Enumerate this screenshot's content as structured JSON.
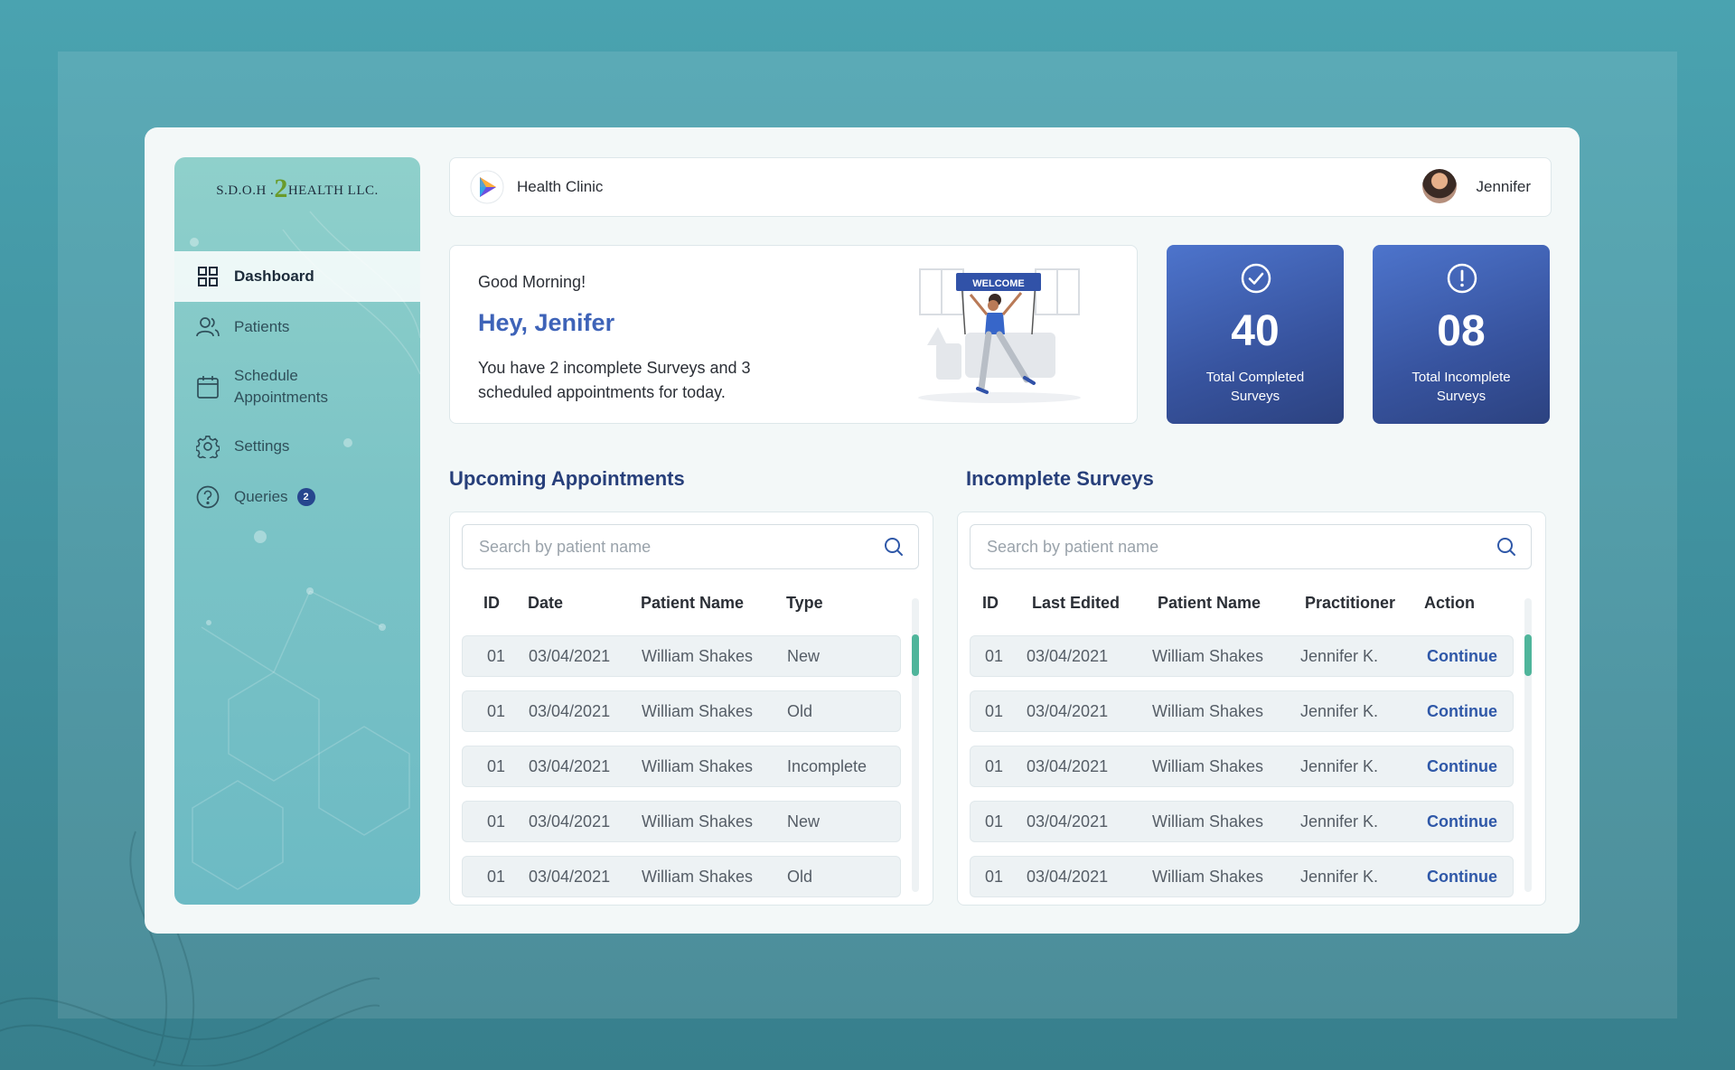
{
  "brand": {
    "logo_prefix": "S.D.O.H .",
    "logo_number": "2",
    "logo_suffix": "HEALTH LLC."
  },
  "sidebar": {
    "items": [
      {
        "label": "Dashboard",
        "icon": "dashboard-grid-icon",
        "active": true
      },
      {
        "label": "Patients",
        "icon": "users-icon"
      },
      {
        "label": "Schedule Appointments",
        "icon": "calendar-icon"
      },
      {
        "label": "Settings",
        "icon": "gear-icon"
      },
      {
        "label": "Queries",
        "icon": "question-circle-icon",
        "badge": "2"
      }
    ]
  },
  "header": {
    "clinic_name": "Health Clinic",
    "user_name": "Jennifer"
  },
  "welcome": {
    "greeting": "Good Morning!",
    "headline": "Hey, Jenifer",
    "message": "You have 2 incomplete Surveys and 3 scheduled appointments for today.",
    "banner_text": "WELCOME"
  },
  "stats": [
    {
      "value": "40",
      "label": "Total Completed Surveys",
      "icon": "check-circle-icon"
    },
    {
      "value": "08",
      "label": "Total Incomplete Surveys",
      "icon": "alert-circle-icon"
    }
  ],
  "appointments": {
    "title": "Upcoming Appointments",
    "search_placeholder": "Search by patient name",
    "columns": [
      "ID",
      "Date",
      "Patient Name",
      "Type"
    ],
    "rows": [
      [
        "01",
        "03/04/2021",
        "William Shakes",
        "New"
      ],
      [
        "01",
        "03/04/2021",
        "William Shakes",
        "Old"
      ],
      [
        "01",
        "03/04/2021",
        "William Shakes",
        "Incomplete"
      ],
      [
        "01",
        "03/04/2021",
        "William Shakes",
        "New"
      ],
      [
        "01",
        "03/04/2021",
        "William Shakes",
        "Old"
      ]
    ]
  },
  "surveys": {
    "title": "Incomplete Surveys",
    "search_placeholder": "Search by patient name",
    "columns": [
      "ID",
      "Last Edited",
      "Patient Name",
      "Practitioner",
      "Action"
    ],
    "rows": [
      [
        "01",
        "03/04/2021",
        "William Shakes",
        "Jennifer K.",
        "Continue"
      ],
      [
        "01",
        "03/04/2021",
        "William Shakes",
        "Jennifer K.",
        "Continue"
      ],
      [
        "01",
        "03/04/2021",
        "William Shakes",
        "Jennifer K.",
        "Continue"
      ],
      [
        "01",
        "03/04/2021",
        "William Shakes",
        "Jennifer K.",
        "Continue"
      ],
      [
        "01",
        "03/04/2021",
        "William Shakes",
        "Jennifer K.",
        "Continue"
      ]
    ]
  },
  "colors": {
    "accent": "#3e63b8",
    "stat_card": "#37539e",
    "scroll_thumb": "#4fb59b",
    "sidebar": "#7cc4c6",
    "background": "#4aa3b0"
  }
}
